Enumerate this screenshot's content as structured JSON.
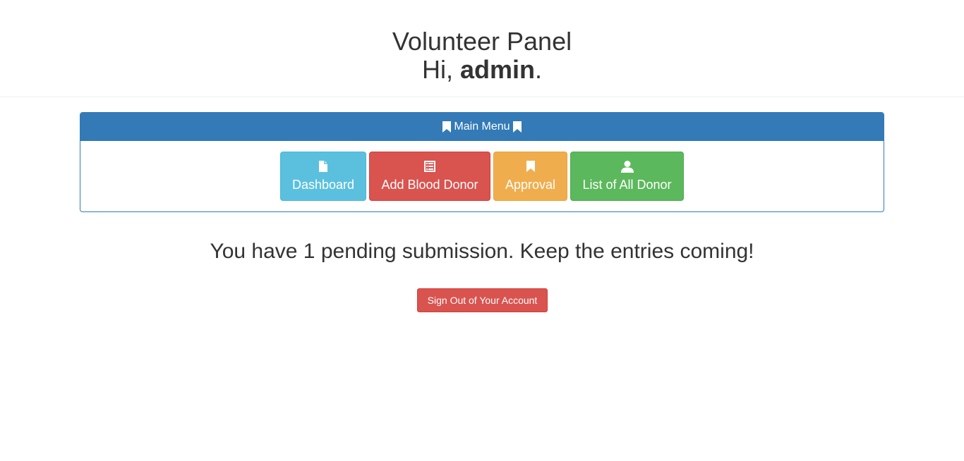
{
  "header": {
    "title": "Volunteer Panel",
    "greeting_prefix": "Hi, ",
    "username": "admin",
    "greeting_suffix": "."
  },
  "menu": {
    "heading": "Main Menu",
    "heading_icon": "bookmark-icon",
    "buttons": [
      {
        "label": "Dashboard",
        "icon": "file-icon",
        "color": "#5bc0de"
      },
      {
        "label": "Add Blood Donor",
        "icon": "list-alt-icon",
        "color": "#d9534f"
      },
      {
        "label": "Approval",
        "icon": "bookmark-icon",
        "color": "#f0ad4e"
      },
      {
        "label": "List of All Donor",
        "icon": "user-icon",
        "color": "#5cb85c"
      }
    ]
  },
  "status": {
    "message": "You have 1 pending submission. Keep the entries coming!"
  },
  "account": {
    "signout_label": "Sign Out of Your Account"
  },
  "colors": {
    "primary": "#337ab7",
    "danger": "#d9534f"
  }
}
